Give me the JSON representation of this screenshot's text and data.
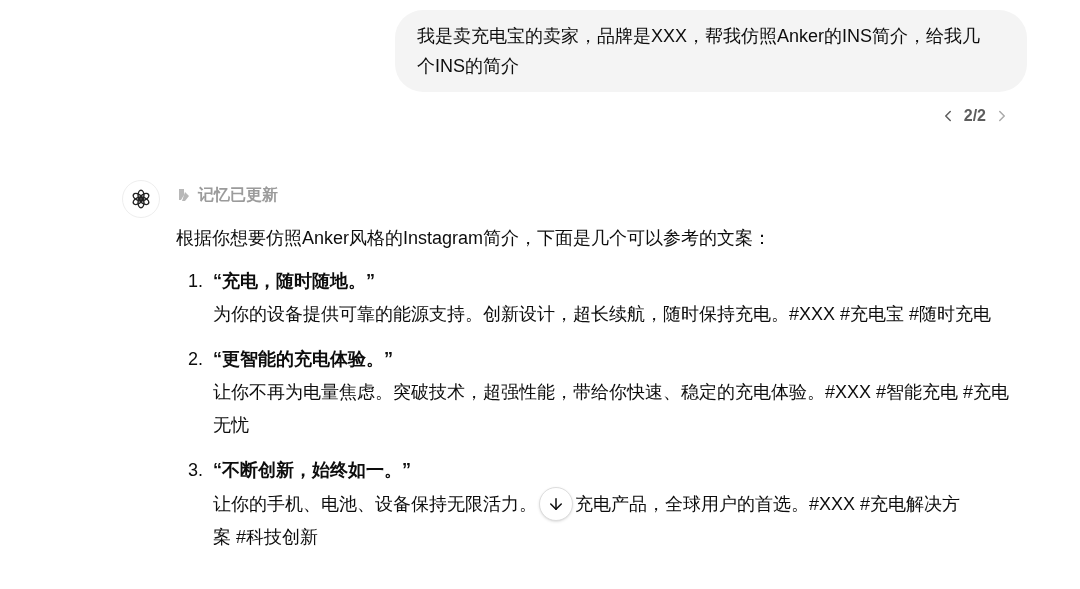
{
  "user_message": {
    "text": "我是卖充电宝的卖家，品牌是XXX，帮我仿照Anker的INS简介，给我几个INS的简介"
  },
  "pager": {
    "text": "2/2"
  },
  "assistant": {
    "status": "记忆已更新",
    "intro": "根据你想要仿照Anker风格的Instagram简介，下面是几个可以参考的文案：",
    "items": [
      {
        "number": "1.",
        "title": "“充电，随时随地。”",
        "description": [
          "为你的设备提供可靠的能源支持。创新设计，超长续航，随时保持充电。#XXX #充电宝 #随时充电"
        ]
      },
      {
        "number": "2.",
        "title": "“更智能的充电体验。”",
        "description": [
          "让你不再为电量焦虑。突破技术，超强性能，带给你快速、稳定的充电体验。#XXX #智能充电 #充电无忧"
        ]
      },
      {
        "number": "3.",
        "title": "“不断创新，始终如一。”",
        "description": [
          "让你的手机、电池、设备保持无限活力。",
          "充电产品，全球用户的首选。#XXX #充电解决方",
          "案 #科技创新"
        ]
      }
    ]
  }
}
